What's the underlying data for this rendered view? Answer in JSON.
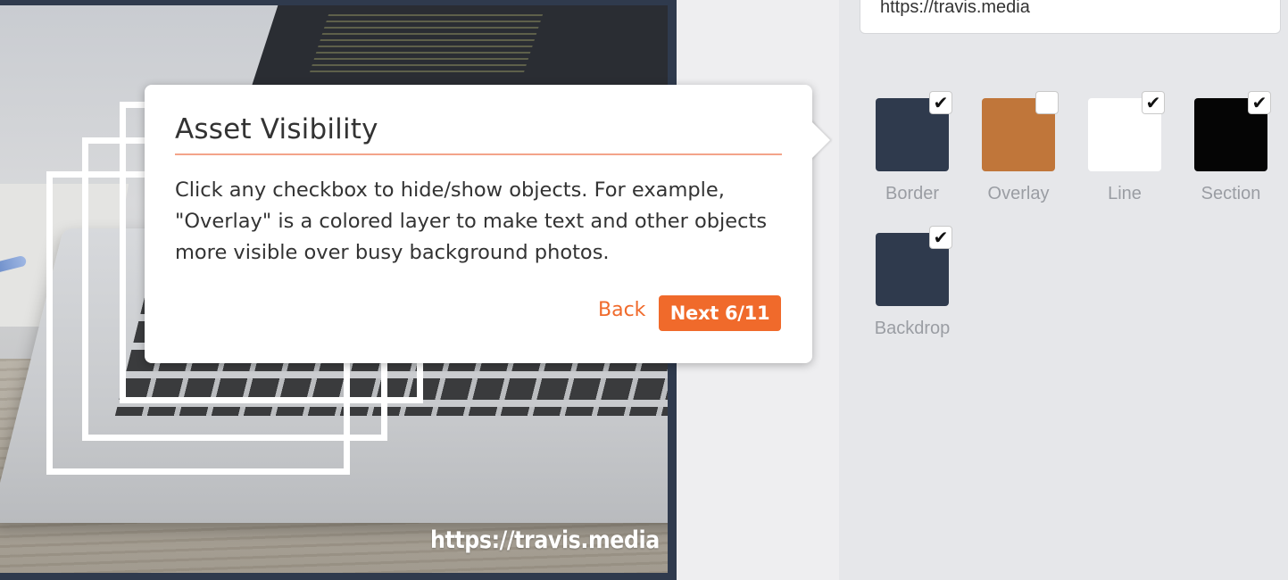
{
  "canvas": {
    "watermark_text": "https://travis.media"
  },
  "settings": {
    "url_value": "https://travis.media",
    "assets": [
      {
        "label": "Border",
        "color": "#2f3a4d",
        "checked": true,
        "check_glyph": "✔"
      },
      {
        "label": "Overlay",
        "color": "#c0763a",
        "checked": false,
        "check_glyph": ""
      },
      {
        "label": "Line",
        "color": "#ffffff",
        "checked": true,
        "check_glyph": "✔"
      },
      {
        "label": "Section",
        "color": "#050505",
        "checked": true,
        "check_glyph": "✔"
      },
      {
        "label": "Backdrop",
        "color": "#2f3a4d",
        "checked": true,
        "check_glyph": "✔"
      }
    ]
  },
  "tour": {
    "title": "Asset Visibility",
    "body": "Click any checkbox to hide/show objects. For example, \"Overlay\" is a colored layer to make text and other objects more visible over busy background photos.",
    "back_label": "Back",
    "next_label": "Next 6/11",
    "accent_color": "#f06a2b"
  }
}
